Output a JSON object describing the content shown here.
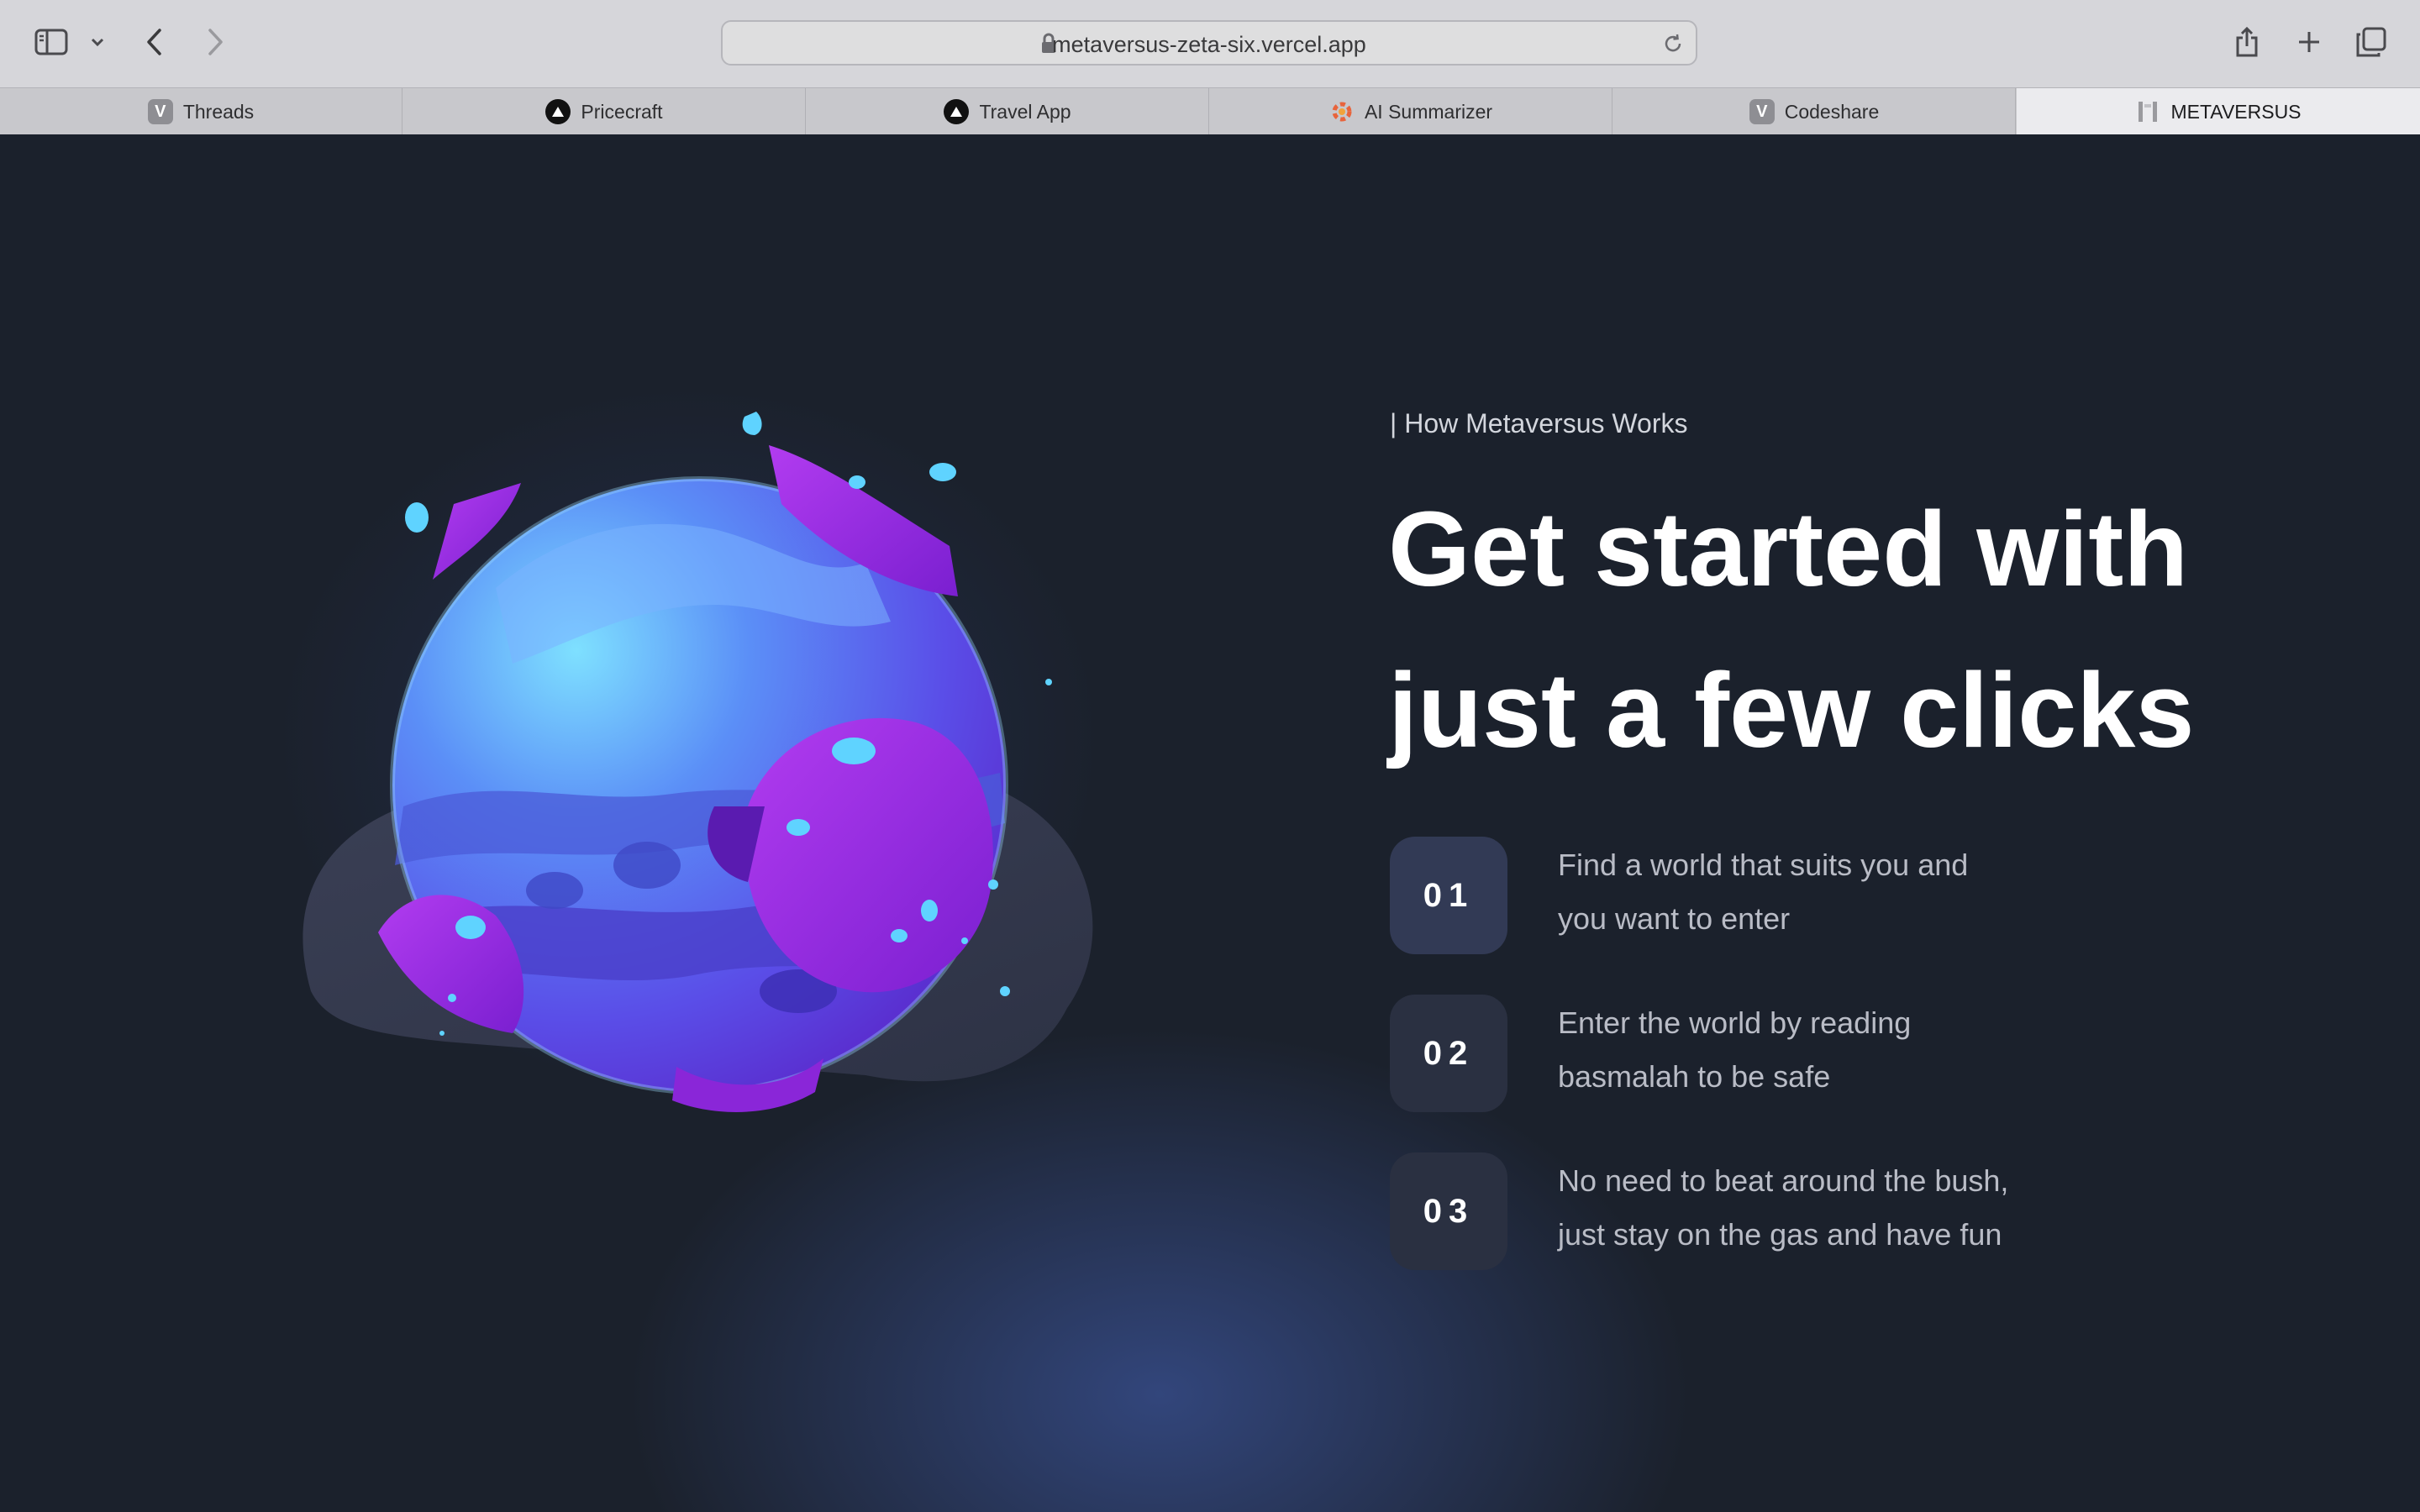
{
  "browser": {
    "url": "metaversus-zeta-six.vercel.app",
    "tabs": [
      {
        "label": "Threads",
        "favicon": "V"
      },
      {
        "label": "Pricecraft",
        "favicon": "triangle"
      },
      {
        "label": "Travel App",
        "favicon": "triangle"
      },
      {
        "label": "AI Summarizer",
        "favicon": "ai-logo"
      },
      {
        "label": "Codeshare",
        "favicon": "V"
      },
      {
        "label": "METAVERSUS",
        "favicon": "metaversus-logo",
        "active": true
      }
    ]
  },
  "section": {
    "eyebrow": "| How Metaversus Works",
    "headline_line1": "Get started with",
    "headline_line2": "just a few clicks",
    "steps": [
      {
        "number": "01",
        "line1": "Find a world that suits you and",
        "line2": "you want to enter"
      },
      {
        "number": "02",
        "line1": "Enter the world by reading",
        "line2": "basmalah to be safe"
      },
      {
        "number": "03",
        "line1": "No need to beat around the bush,",
        "line2": "just stay on the gas and have fun"
      }
    ]
  },
  "colors": {
    "background": "#1b212c",
    "step_badge": "#323a55",
    "planet_blue": "#5a7bf5",
    "crystal_purple": "#9b2fe0",
    "sparkle_cyan": "#5fd3ff"
  }
}
